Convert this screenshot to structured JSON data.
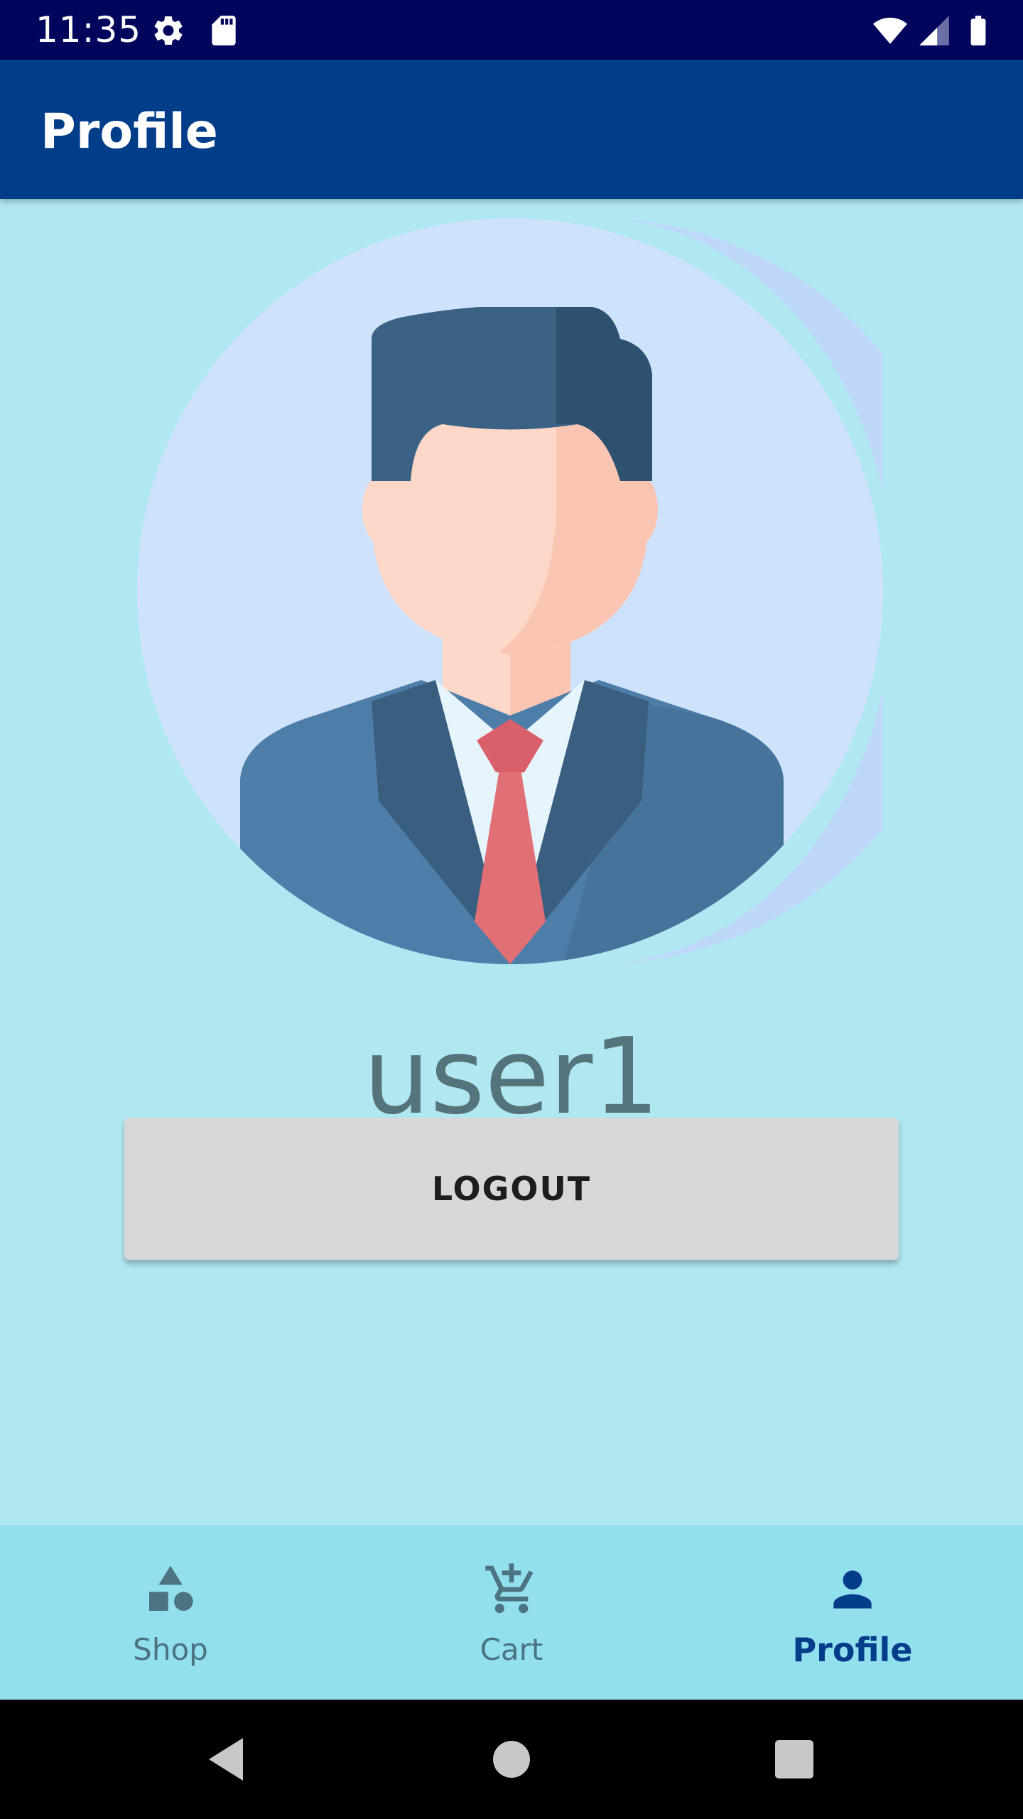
{
  "status_bar": {
    "time": "11:35",
    "icons": [
      "settings-icon",
      "sd-card-icon",
      "wifi-icon",
      "signal-icon",
      "battery-icon"
    ]
  },
  "app_bar": {
    "title": "Profile"
  },
  "profile": {
    "avatar": "businessman-avatar",
    "username": "user1"
  },
  "logout_button": {
    "label": "LOGOUT"
  },
  "bottom_nav": {
    "items": [
      {
        "label": "Shop",
        "icon": "shapes-icon",
        "active": false
      },
      {
        "label": "Cart",
        "icon": "add-shopping-cart-icon",
        "active": false
      },
      {
        "label": "Profile",
        "icon": "person-icon",
        "active": true
      }
    ]
  },
  "system_nav": {
    "buttons": [
      "back-icon",
      "home-icon",
      "recents-icon"
    ]
  },
  "colors": {
    "status_bar": "#02055c",
    "app_bar": "#023d8a",
    "background": "#b0e8f2",
    "bottom_nav": "#92dfee",
    "active_nav": "#023d8a",
    "inactive_nav": "#4b7380",
    "button": "#d7d8d9"
  }
}
